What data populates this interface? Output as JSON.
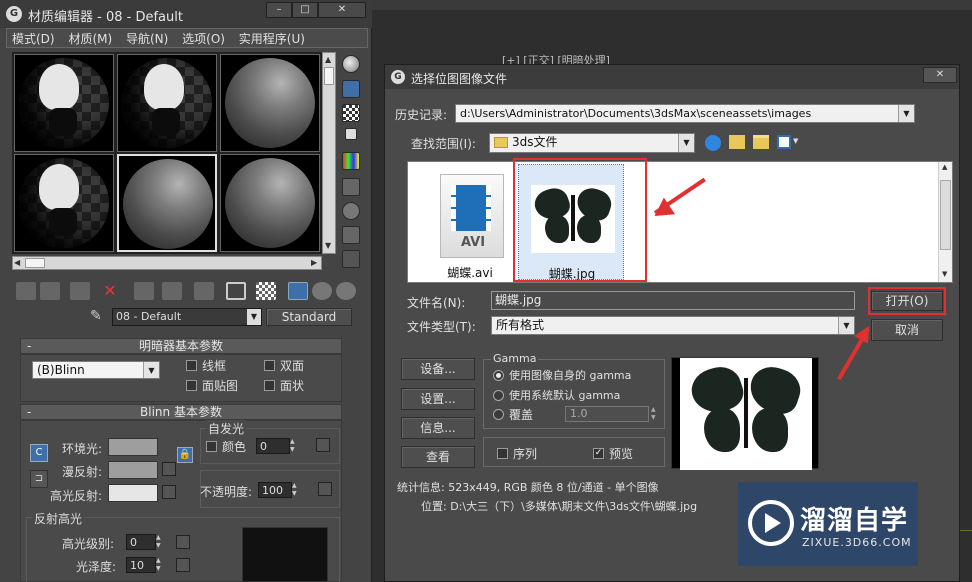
{
  "material_editor": {
    "title": "材质编辑器 - 08 - Default",
    "menu": [
      "模式(D)",
      "材质(M)",
      "导航(N)",
      "选项(O)",
      "实用程序(U)"
    ],
    "material_name": "08 - Default",
    "material_type": "Standard",
    "shader_rollout": "明暗器基本参数",
    "shader_type": "(B)Blinn",
    "wire_label": "线框",
    "two_sided_label": "双面",
    "face_map_label": "面贴图",
    "faceted_label": "面状",
    "blinn_rollout": "Blinn 基本参数",
    "self_illum_group": "自发光",
    "color_label": "颜色",
    "self_illum_value": "0",
    "ambient_label": "环境光:",
    "diffuse_label": "漫反射:",
    "specular_label": "高光反射:",
    "opacity_label": "不透明度:",
    "opacity_value": "100",
    "spec_highlights_group": "反射高光",
    "spec_level_label": "高光级别:",
    "spec_level_value": "0",
    "glossiness_label": "光泽度:",
    "glossiness_value": "10",
    "lock_icon": "lock-icon"
  },
  "viewport": {
    "label": "[+] [正交] [明暗处理]"
  },
  "file_dialog": {
    "title": "选择位图图像文件",
    "history_label": "历史记录:",
    "history_value": "d:\\Users\\Administrator\\Documents\\3dsMax\\sceneassets\\images",
    "look_in_label": "查找范围(I):",
    "look_in_value": "3ds文件",
    "files": [
      {
        "name": "蝴蝶.avi",
        "type": "video",
        "badge": "AVI"
      },
      {
        "name": "蝴蝶.jpg",
        "type": "image"
      }
    ],
    "filename_label": "文件名(N):",
    "filename_value": "蝴蝶.jpg",
    "filetype_label": "文件类型(T):",
    "filetype_value": "所有格式",
    "open_button": "打开(O)",
    "cancel_button": "取消",
    "setup_button": "设备...",
    "settings_button": "设置...",
    "info_button": "信息...",
    "view_button": "查看",
    "gamma_group": "Gamma",
    "gamma_options": [
      "使用图像自身的 gamma",
      "使用系统默认 gamma",
      "覆盖"
    ],
    "gamma_override_value": "1.0",
    "sequence_label": "序列",
    "preview_label": "预览",
    "stats_text": "统计信息: 523x449, RGB 颜色 8 位/通道 - 单个图像",
    "location_text": "位置: D:\\大三（下）\\多媒体\\期末文件\\3ds文件\\蝴蝶.jpg"
  },
  "watermark": {
    "brand": "溜溜自学",
    "url": "ZIXUE.3D66.COM"
  },
  "colors": {
    "annotation_red": "#e03030",
    "panel_bg": "#444444",
    "dialog_bg": "#4a4a4a"
  }
}
